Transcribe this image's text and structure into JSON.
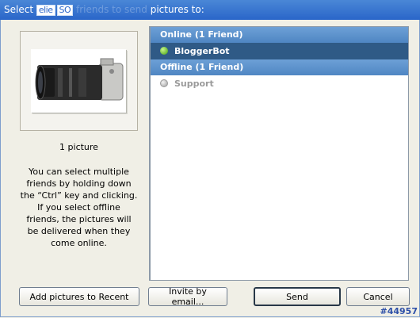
{
  "window": {
    "title_prefix": "Select",
    "title_obscured": "friends to send",
    "title_suffix": "pictures to:",
    "logo_text": "elie",
    "logo_text2": "SO"
  },
  "preview": {
    "count_text": "1 picture",
    "help_text": "You can select multiple friends by holding down the “Ctrl” key and clicking.  If you select offline friends, the pictures will be delivered when they come online."
  },
  "friends": {
    "online_header": "Online (1 Friend)",
    "offline_header": "Offline (1 Friend)",
    "online": [
      {
        "name": "BloggerBot",
        "status": "online"
      }
    ],
    "offline": [
      {
        "name": "Support",
        "status": "offline"
      }
    ]
  },
  "buttons": {
    "add_recent": "Add pictures to Recent",
    "invite": "Invite by email...",
    "send": "Send",
    "cancel": "Cancel"
  },
  "footer": {
    "id": "#44957"
  },
  "colors": {
    "titlebar": "#2a66c9",
    "group_header": "#5a8fc9",
    "selected_row": "#2f5a86"
  }
}
